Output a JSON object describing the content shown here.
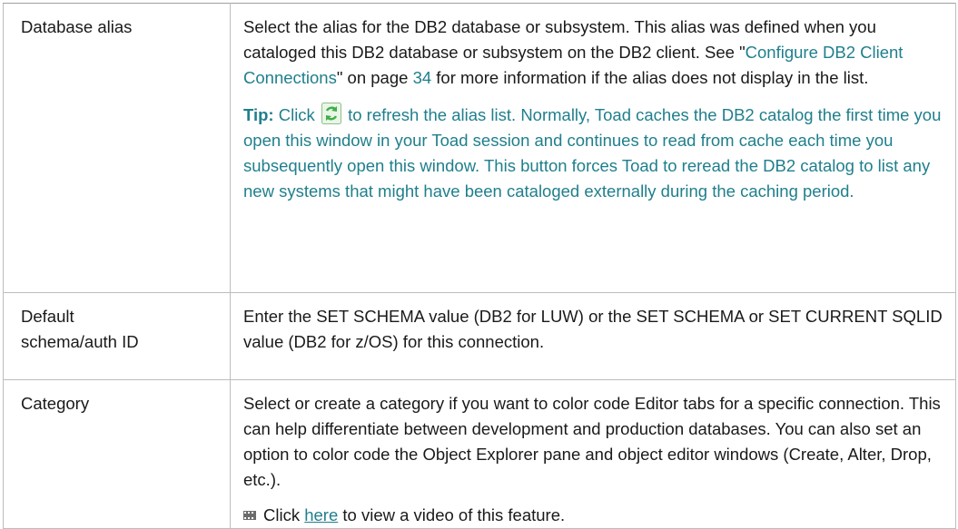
{
  "rows": [
    {
      "term": "Database alias",
      "desc_parts": {
        "p1_a": "Select the alias for the DB2 database or subsystem. This alias was defined when you cataloged this DB2 database or subsystem on the DB2 client. See \"",
        "p1_link": "Configure DB2 Client Connections",
        "p1_b": "\" on page ",
        "p1_page": "34",
        "p1_c": " for more information if the alias does not display in the list.",
        "tip_label": "Tip:",
        "tip_a": " Click ",
        "tip_b": " to refresh the alias list. Normally, Toad caches the DB2 catalog the first time you open this window in your Toad session and continues to read from cache each time you subsequently open this window. This button forces Toad to reread the DB2 catalog to list any new systems that might have been cataloged externally during the caching period."
      }
    },
    {
      "term_line1": "Default",
      "term_line2": "schema/auth ID",
      "desc": "Enter the SET SCHEMA value (DB2 for LUW) or the SET SCHEMA or SET CURRENT SQLID value (DB2 for z/OS) for this connection."
    },
    {
      "term": "Category",
      "desc": "Select or create a category if you want to color code Editor tabs for a specific connection. This can help differentiate between development and production databases. You can also set an option to color code the Object Explorer pane and object editor windows (Create, Alter, Drop, etc.).",
      "video_a": "Click ",
      "video_link": "here",
      "video_b": " to view a video of this feature."
    }
  ],
  "icons": {
    "refresh": "refresh-icon",
    "video": "video-icon"
  },
  "colors": {
    "link": "#1f7f8c",
    "border": "#bdbdbd",
    "refresh_icon": "#3fae49"
  }
}
